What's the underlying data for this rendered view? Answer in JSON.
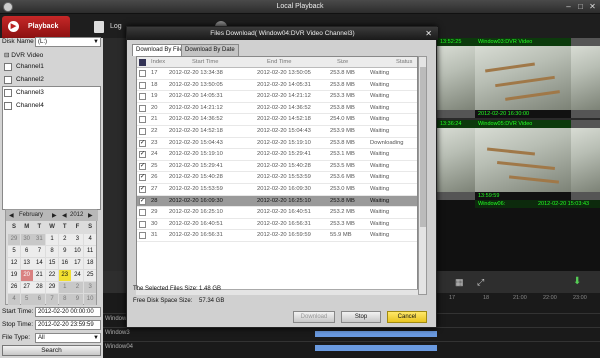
{
  "window": {
    "title": "Local Playback"
  },
  "tabs": {
    "playback": "Playback",
    "log": "Log"
  },
  "left": {
    "disk_name_label": "Disk Name",
    "disk_name_value": "(L:)",
    "tree_root": "DVR Video",
    "channels": [
      "Channel1",
      "Channel2",
      "Channel3",
      "Channel4"
    ],
    "calendar": {
      "month": "February",
      "year": "2012",
      "day_names": [
        "S",
        "M",
        "T",
        "W",
        "T",
        "F",
        "S"
      ],
      "days": [
        {
          "d": "29",
          "k": "gry"
        },
        {
          "d": "30",
          "k": "gry"
        },
        {
          "d": "31",
          "k": "gry"
        },
        {
          "d": "1",
          "k": "plain"
        },
        {
          "d": "2",
          "k": "plain"
        },
        {
          "d": "3",
          "k": "plain"
        },
        {
          "d": "4",
          "k": "plain"
        },
        {
          "d": "5",
          "k": "plain"
        },
        {
          "d": "6",
          "k": "plain"
        },
        {
          "d": "7",
          "k": "plain"
        },
        {
          "d": "8",
          "k": "plain"
        },
        {
          "d": "9",
          "k": "plain"
        },
        {
          "d": "10",
          "k": "plain"
        },
        {
          "d": "11",
          "k": "plain"
        },
        {
          "d": "12",
          "k": "plain"
        },
        {
          "d": "13",
          "k": "plain"
        },
        {
          "d": "14",
          "k": "plain"
        },
        {
          "d": "15",
          "k": "plain"
        },
        {
          "d": "16",
          "k": "plain"
        },
        {
          "d": "17",
          "k": "plain"
        },
        {
          "d": "18",
          "k": "plain"
        },
        {
          "d": "19",
          "k": "plain"
        },
        {
          "d": "20",
          "k": "rec"
        },
        {
          "d": "21",
          "k": "plain"
        },
        {
          "d": "22",
          "k": "plain"
        },
        {
          "d": "23",
          "k": "tdy"
        },
        {
          "d": "24",
          "k": "plain"
        },
        {
          "d": "25",
          "k": "plain"
        },
        {
          "d": "26",
          "k": "plain"
        },
        {
          "d": "27",
          "k": "plain"
        },
        {
          "d": "28",
          "k": "plain"
        },
        {
          "d": "29",
          "k": "plain"
        },
        {
          "d": "1",
          "k": "gry"
        },
        {
          "d": "2",
          "k": "gry"
        },
        {
          "d": "3",
          "k": "gry"
        },
        {
          "d": "4",
          "k": "gry"
        },
        {
          "d": "5",
          "k": "gry"
        },
        {
          "d": "6",
          "k": "gry"
        },
        {
          "d": "7",
          "k": "gry"
        },
        {
          "d": "8",
          "k": "gry"
        },
        {
          "d": "9",
          "k": "gry"
        },
        {
          "d": "10",
          "k": "gry"
        }
      ]
    },
    "start_time_label": "Start Time:",
    "start_time_value": "2012-02-20 00:00:00",
    "stop_time_label": "Stop Time:",
    "stop_time_value": "2012-02-20 23:59:59",
    "file_type_label": "File Type:",
    "file_type_value": "All",
    "search_label": "Search"
  },
  "video": {
    "tile1_title": "Window03:DVR Video",
    "tile2_title": "Window05:DVR Video",
    "tile3_title": "Window06:",
    "tile1_date": "2012-02-20 16:30:00",
    "tile1_small_date": "13:52:25",
    "tile2_small_date": "13:36:24",
    "tile3_small_date": "13:59:59",
    "tile3_date": "2012-02-20 15:03:43"
  },
  "timeline": {
    "rows": [
      "Window2",
      "Window3",
      "Window04"
    ],
    "ticks": [
      "17",
      "18",
      "21:00",
      "22:00",
      "23:00"
    ]
  },
  "dialog": {
    "title": "Files Download( Window04:DVR Video Channel3)",
    "tab_file": "Download By File",
    "tab_date": "Download By Date",
    "columns": {
      "index": "Index",
      "start": "Start Time",
      "end": "End Time",
      "size": "Size",
      "status": "Status"
    },
    "rows": [
      {
        "checked": false,
        "idx": "17",
        "start": "2012-02-20 13:34:38",
        "end": "2012-02-20 13:50:05",
        "size": "253.8 MB",
        "status": "Waiting",
        "selected": false
      },
      {
        "checked": false,
        "idx": "18",
        "start": "2012-02-20 13:50:05",
        "end": "2012-02-20 14:05:31",
        "size": "253.8 MB",
        "status": "Waiting",
        "selected": false
      },
      {
        "checked": false,
        "idx": "19",
        "start": "2012-02-20 14:05:31",
        "end": "2012-02-20 14:21:12",
        "size": "253.3 MB",
        "status": "Waiting",
        "selected": false
      },
      {
        "checked": false,
        "idx": "20",
        "start": "2012-02-20 14:21:12",
        "end": "2012-02-20 14:36:52",
        "size": "253.8 MB",
        "status": "Waiting",
        "selected": false
      },
      {
        "checked": false,
        "idx": "21",
        "start": "2012-02-20 14:36:52",
        "end": "2012-02-20 14:52:18",
        "size": "254.0 MB",
        "status": "Waiting",
        "selected": false
      },
      {
        "checked": false,
        "idx": "22",
        "start": "2012-02-20 14:52:18",
        "end": "2012-02-20 15:04:43",
        "size": "253.9 MB",
        "status": "Waiting",
        "selected": false
      },
      {
        "checked": true,
        "idx": "23",
        "start": "2012-02-20 15:04:43",
        "end": "2012-02-20 15:19:10",
        "size": "253.8 MB",
        "status": "Downloading",
        "selected": false
      },
      {
        "checked": true,
        "idx": "24",
        "start": "2012-02-20 15:19:10",
        "end": "2012-02-20 15:29:41",
        "size": "253.1 MB",
        "status": "Waiting",
        "selected": false
      },
      {
        "checked": true,
        "idx": "25",
        "start": "2012-02-20 15:29:41",
        "end": "2012-02-20 15:40:28",
        "size": "253.5 MB",
        "status": "Waiting",
        "selected": false
      },
      {
        "checked": true,
        "idx": "26",
        "start": "2012-02-20 15:40:28",
        "end": "2012-02-20 15:53:59",
        "size": "253.6 MB",
        "status": "Waiting",
        "selected": false
      },
      {
        "checked": true,
        "idx": "27",
        "start": "2012-02-20 15:53:59",
        "end": "2012-02-20 16:09:30",
        "size": "253.0 MB",
        "status": "Waiting",
        "selected": false
      },
      {
        "checked": true,
        "idx": "28",
        "start": "2012-02-20 16:09:30",
        "end": "2012-02-20 16:25:10",
        "size": "253.8 MB",
        "status": "Waiting",
        "selected": true
      },
      {
        "checked": false,
        "idx": "29",
        "start": "2012-02-20 16:25:10",
        "end": "2012-02-20 16:40:51",
        "size": "253.2 MB",
        "status": "Waiting",
        "selected": false
      },
      {
        "checked": false,
        "idx": "30",
        "start": "2012-02-20 16:40:51",
        "end": "2012-02-20 16:56:31",
        "size": "253.3 MB",
        "status": "Waiting",
        "selected": false
      },
      {
        "checked": false,
        "idx": "31",
        "start": "2012-02-20 16:56:31",
        "end": "2012-02-20 16:59:59",
        "size": "55.9 MB",
        "status": "Waiting",
        "selected": false
      }
    ],
    "selected_size_label": "The Selected Files Size:",
    "selected_size_value": "1.48 GB",
    "free_space_label": "Free Disk Space Size:",
    "free_space_value": "57.34 GB",
    "btn_download": "Download",
    "btn_stop": "Stop",
    "btn_cancel": "Cancel"
  }
}
